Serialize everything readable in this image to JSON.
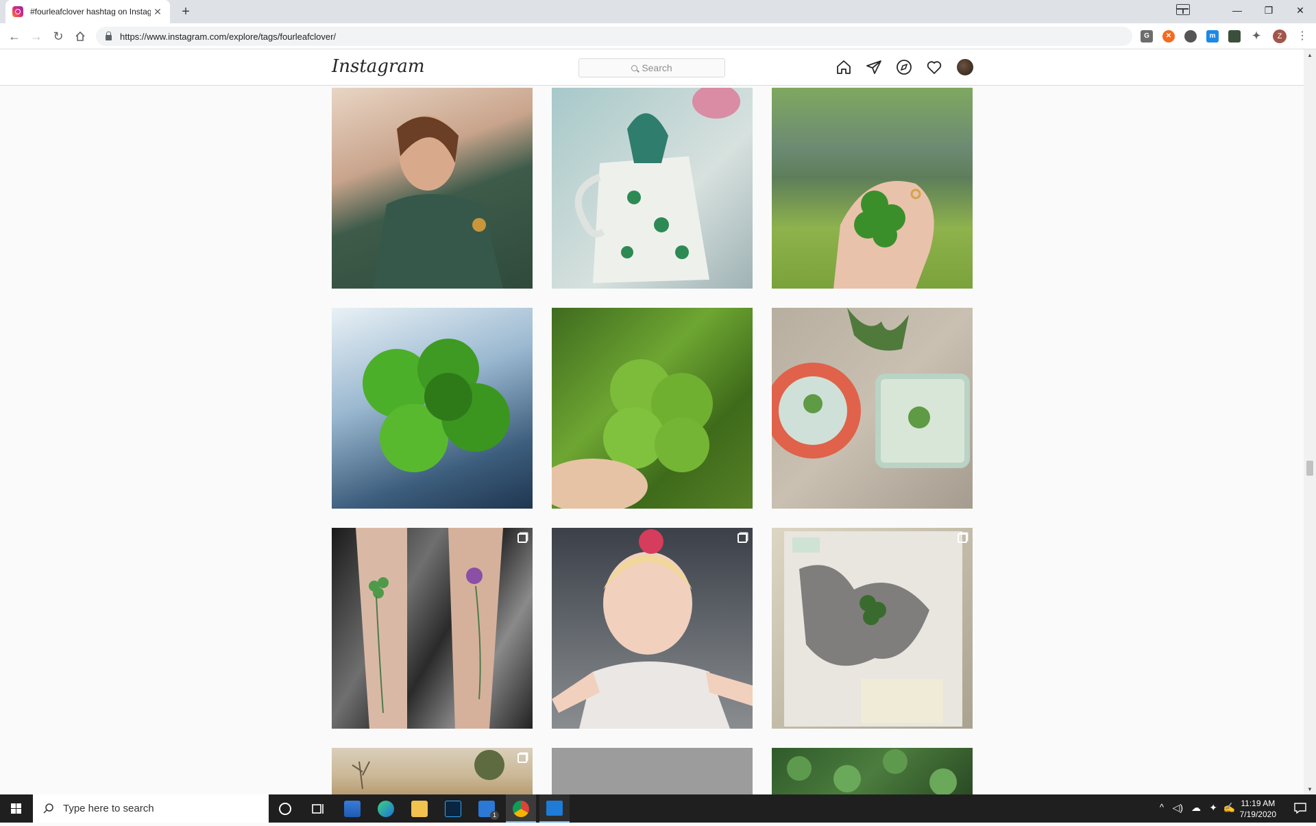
{
  "browser": {
    "tab_title": "#fourleafclover hashtag on Instagram",
    "tab_close": "✕",
    "new_tab": "+",
    "url": "https://www.instagram.com/explore/tags/fourleafclover/",
    "window_minimize": "—",
    "window_restore": "❐",
    "window_close": "✕",
    "profile_initial": "Z",
    "menu": "⋮",
    "back": "←",
    "forward": "→",
    "reload": "↻"
  },
  "instagram": {
    "logo": "Instagram",
    "search_placeholder": "Search",
    "nav_icons": [
      "home-icon",
      "direct-messages-icon",
      "explore-icon",
      "activity-heart-icon",
      "profile-avatar"
    ],
    "posts": [
      {
        "subject": "woman-green-jumpsuit",
        "multi": false
      },
      {
        "subject": "clover-pitcher-painting",
        "multi": false
      },
      {
        "subject": "four-leaf-clover-ring-hand",
        "multi": false
      },
      {
        "subject": "clover-water-droplets",
        "multi": false
      },
      {
        "subject": "clover-in-grass",
        "multi": false
      },
      {
        "subject": "clover-resin-coasters",
        "multi": false
      },
      {
        "subject": "clover-forearm-tattoos",
        "multi": true
      },
      {
        "subject": "toddler-pink-bow",
        "multi": true
      },
      {
        "subject": "clover-collage-art",
        "multi": true
      },
      {
        "subject": "field-landscape",
        "multi": true
      },
      {
        "subject": "gray-photo",
        "multi": false
      },
      {
        "subject": "clover-patch",
        "multi": false
      }
    ]
  },
  "taskbar": {
    "search_placeholder": "Type here to search",
    "time": "11:19 AM",
    "date": "7/19/2020",
    "mail_badge": "1"
  },
  "colors": {
    "instagram_border": "#dbdbdb",
    "taskbar": "#1f1f1f",
    "chrome_tabbar": "#dee1e6"
  }
}
